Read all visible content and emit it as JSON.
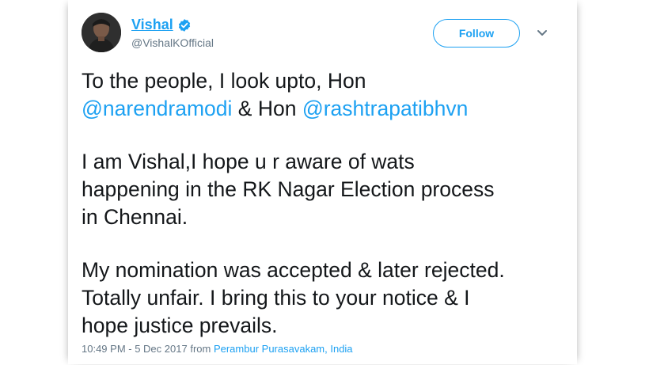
{
  "author": {
    "name": "Vishal",
    "handle": "@VishalKOfficial"
  },
  "follow_label": "Follow",
  "tweet": {
    "p1_prefix": "To the people, I look upto, Hon",
    "mention1": "@narendramodi",
    "p1_mid": "& Hon",
    "mention2": "@rashtrapatibhvn",
    "p2_line1": "I am Vishal,I hope u r aware of wats",
    "p2_line2": "happening in the RK Nagar Election process",
    "p2_line3": "in Chennai.",
    "p3_line1": "My nomination was accepted & later rejected.",
    "p3_line2": "Totally unfair. I bring this to your notice & I",
    "p3_line3": "hope justice prevails."
  },
  "meta": {
    "time": "10:49 PM - 5 Dec 2017",
    "from": "from",
    "location": "Perambur Purasavakam, India"
  },
  "icons": {
    "verified": "verified-badge-icon",
    "more": "chevron-down-icon"
  },
  "colors": {
    "accent": "#1da1f2",
    "text": "#14171a",
    "muted": "#657786"
  }
}
